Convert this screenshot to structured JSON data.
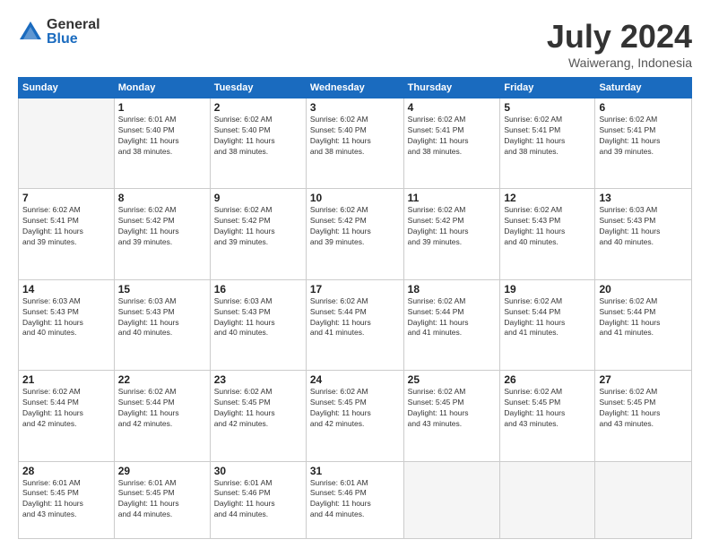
{
  "logo": {
    "general": "General",
    "blue": "Blue"
  },
  "title": {
    "month_year": "July 2024",
    "location": "Waiwerang, Indonesia"
  },
  "days_of_week": [
    "Sunday",
    "Monday",
    "Tuesday",
    "Wednesday",
    "Thursday",
    "Friday",
    "Saturday"
  ],
  "weeks": [
    [
      {
        "day": "",
        "info": ""
      },
      {
        "day": "1",
        "info": "Sunrise: 6:01 AM\nSunset: 5:40 PM\nDaylight: 11 hours\nand 38 minutes."
      },
      {
        "day": "2",
        "info": "Sunrise: 6:02 AM\nSunset: 5:40 PM\nDaylight: 11 hours\nand 38 minutes."
      },
      {
        "day": "3",
        "info": "Sunrise: 6:02 AM\nSunset: 5:40 PM\nDaylight: 11 hours\nand 38 minutes."
      },
      {
        "day": "4",
        "info": "Sunrise: 6:02 AM\nSunset: 5:41 PM\nDaylight: 11 hours\nand 38 minutes."
      },
      {
        "day": "5",
        "info": "Sunrise: 6:02 AM\nSunset: 5:41 PM\nDaylight: 11 hours\nand 38 minutes."
      },
      {
        "day": "6",
        "info": "Sunrise: 6:02 AM\nSunset: 5:41 PM\nDaylight: 11 hours\nand 39 minutes."
      }
    ],
    [
      {
        "day": "7",
        "info": "Sunrise: 6:02 AM\nSunset: 5:41 PM\nDaylight: 11 hours\nand 39 minutes."
      },
      {
        "day": "8",
        "info": "Sunrise: 6:02 AM\nSunset: 5:42 PM\nDaylight: 11 hours\nand 39 minutes."
      },
      {
        "day": "9",
        "info": "Sunrise: 6:02 AM\nSunset: 5:42 PM\nDaylight: 11 hours\nand 39 minutes."
      },
      {
        "day": "10",
        "info": "Sunrise: 6:02 AM\nSunset: 5:42 PM\nDaylight: 11 hours\nand 39 minutes."
      },
      {
        "day": "11",
        "info": "Sunrise: 6:02 AM\nSunset: 5:42 PM\nDaylight: 11 hours\nand 39 minutes."
      },
      {
        "day": "12",
        "info": "Sunrise: 6:02 AM\nSunset: 5:43 PM\nDaylight: 11 hours\nand 40 minutes."
      },
      {
        "day": "13",
        "info": "Sunrise: 6:03 AM\nSunset: 5:43 PM\nDaylight: 11 hours\nand 40 minutes."
      }
    ],
    [
      {
        "day": "14",
        "info": "Sunrise: 6:03 AM\nSunset: 5:43 PM\nDaylight: 11 hours\nand 40 minutes."
      },
      {
        "day": "15",
        "info": "Sunrise: 6:03 AM\nSunset: 5:43 PM\nDaylight: 11 hours\nand 40 minutes."
      },
      {
        "day": "16",
        "info": "Sunrise: 6:03 AM\nSunset: 5:43 PM\nDaylight: 11 hours\nand 40 minutes."
      },
      {
        "day": "17",
        "info": "Sunrise: 6:02 AM\nSunset: 5:44 PM\nDaylight: 11 hours\nand 41 minutes."
      },
      {
        "day": "18",
        "info": "Sunrise: 6:02 AM\nSunset: 5:44 PM\nDaylight: 11 hours\nand 41 minutes."
      },
      {
        "day": "19",
        "info": "Sunrise: 6:02 AM\nSunset: 5:44 PM\nDaylight: 11 hours\nand 41 minutes."
      },
      {
        "day": "20",
        "info": "Sunrise: 6:02 AM\nSunset: 5:44 PM\nDaylight: 11 hours\nand 41 minutes."
      }
    ],
    [
      {
        "day": "21",
        "info": "Sunrise: 6:02 AM\nSunset: 5:44 PM\nDaylight: 11 hours\nand 42 minutes."
      },
      {
        "day": "22",
        "info": "Sunrise: 6:02 AM\nSunset: 5:44 PM\nDaylight: 11 hours\nand 42 minutes."
      },
      {
        "day": "23",
        "info": "Sunrise: 6:02 AM\nSunset: 5:45 PM\nDaylight: 11 hours\nand 42 minutes."
      },
      {
        "day": "24",
        "info": "Sunrise: 6:02 AM\nSunset: 5:45 PM\nDaylight: 11 hours\nand 42 minutes."
      },
      {
        "day": "25",
        "info": "Sunrise: 6:02 AM\nSunset: 5:45 PM\nDaylight: 11 hours\nand 43 minutes."
      },
      {
        "day": "26",
        "info": "Sunrise: 6:02 AM\nSunset: 5:45 PM\nDaylight: 11 hours\nand 43 minutes."
      },
      {
        "day": "27",
        "info": "Sunrise: 6:02 AM\nSunset: 5:45 PM\nDaylight: 11 hours\nand 43 minutes."
      }
    ],
    [
      {
        "day": "28",
        "info": "Sunrise: 6:01 AM\nSunset: 5:45 PM\nDaylight: 11 hours\nand 43 minutes."
      },
      {
        "day": "29",
        "info": "Sunrise: 6:01 AM\nSunset: 5:45 PM\nDaylight: 11 hours\nand 44 minutes."
      },
      {
        "day": "30",
        "info": "Sunrise: 6:01 AM\nSunset: 5:46 PM\nDaylight: 11 hours\nand 44 minutes."
      },
      {
        "day": "31",
        "info": "Sunrise: 6:01 AM\nSunset: 5:46 PM\nDaylight: 11 hours\nand 44 minutes."
      },
      {
        "day": "",
        "info": ""
      },
      {
        "day": "",
        "info": ""
      },
      {
        "day": "",
        "info": ""
      }
    ]
  ]
}
